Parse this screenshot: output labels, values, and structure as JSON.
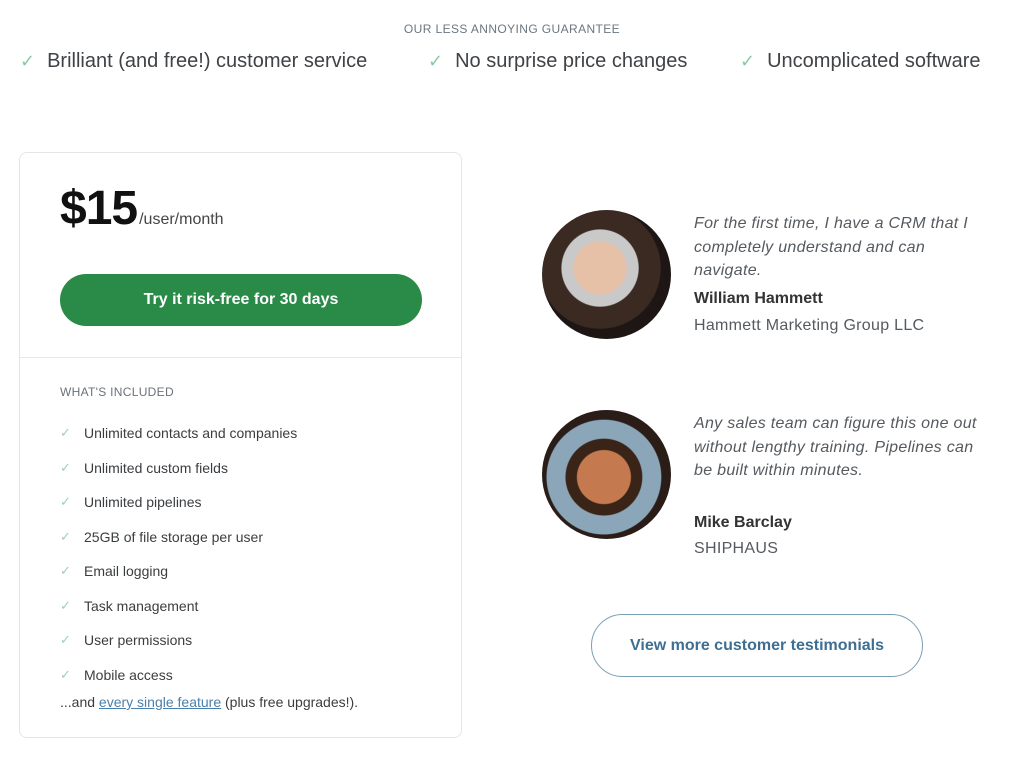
{
  "guarantee": {
    "title": "OUR LESS ANNOYING GUARANTEE",
    "check_icon": "✓",
    "items": [
      "Brilliant (and free!) customer service",
      "No surprise price changes",
      "Uncomplicated software"
    ]
  },
  "pricing": {
    "amount": "$15",
    "unit": "/user/month",
    "cta_label": "Try it risk-free for 30 days",
    "cta_color": "#2a8a47",
    "included_title": "WHAT'S INCLUDED",
    "check_icon": "✓",
    "features": [
      "Unlimited contacts and companies",
      "Unlimited custom fields",
      "Unlimited pipelines",
      "25GB of file storage per user",
      "Email logging",
      "Task management",
      "User permissions",
      "Mobile access"
    ],
    "more_prefix": "...and ",
    "more_link": "every single feature",
    "more_suffix": " (plus free upgrades!)."
  },
  "testimonials": [
    {
      "quote": "For the first time, I have a CRM that I completely understand and can navigate.",
      "author": "William Hammett",
      "company": "Hammett Marketing Group LLC"
    },
    {
      "quote": "Any sales team can figure this one out without lengthy training. Pipelines can be built within minutes.",
      "author": "Mike Barclay",
      "company": "SHIPHAUS"
    }
  ],
  "more_testimonials_label": "View more customer testimonials"
}
